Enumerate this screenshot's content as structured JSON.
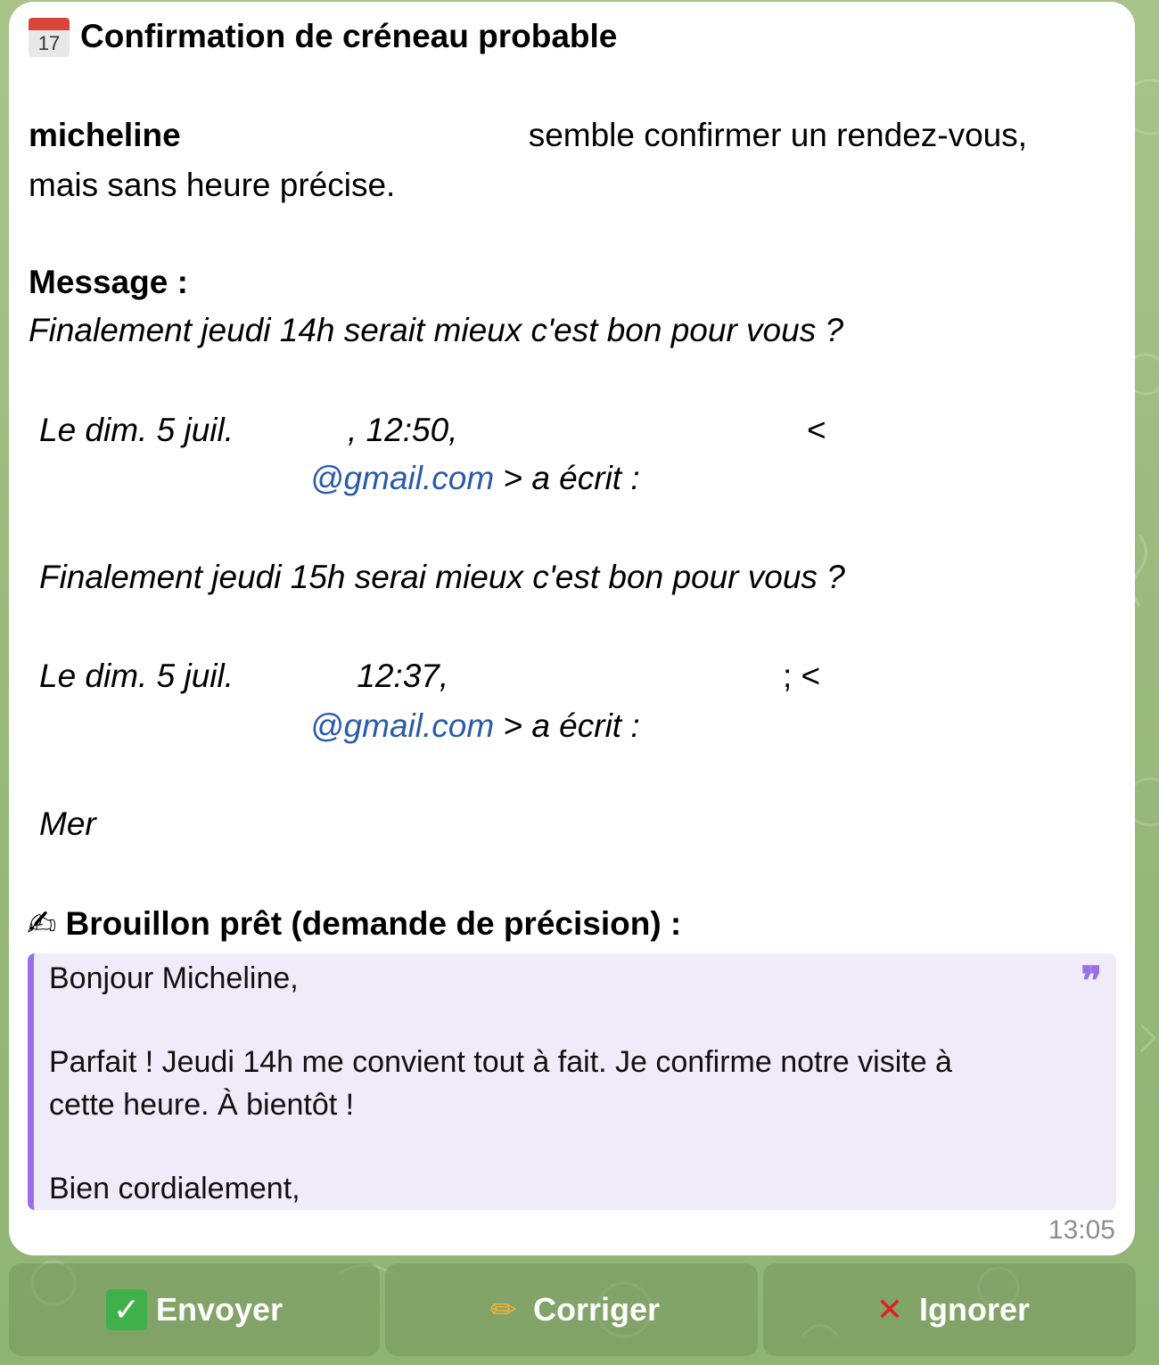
{
  "colors": {
    "wallpaper": "#a0bf85",
    "bubble": "#ffffff",
    "link": "#2a5aa8",
    "quote_background": "#efebf8",
    "quote_accent": "#9c6ee6",
    "timestamp": "#8e8e8e",
    "keyboard_button": "#7f9c68"
  },
  "header": {
    "icon": "calendar-icon",
    "calendar_number": "17",
    "title": "Confirmation de créneau probable"
  },
  "intro": {
    "name": "micheline",
    "text_end": "semble confirmer un rendez-vous,",
    "line2": "mais sans heure précise."
  },
  "message": {
    "label": "Message :",
    "body": "Finalement jeudi 14h serait mieux c'est bon pour vous ?"
  },
  "quoted_thread": [
    {
      "header_start": "Le dim. 5 juil.",
      "header_time": ", 12:50,",
      "header_lt": "<",
      "email_domain": "@gmail.com",
      "wrote": " > a écrit :",
      "body": "Finalement jeudi 15h serai mieux c'est bon pour vous ?"
    },
    {
      "header_start": "Le dim. 5 juil.",
      "header_time": " 12:37,",
      "header_lt": "; <",
      "email_domain": "@gmail.com",
      "wrote": " > a écrit :",
      "body": "Mer"
    }
  ],
  "draft": {
    "icon": "writing-hand-icon",
    "title": "Brouillon prêt (demande de précision) :",
    "quote_icon": "quote-icon",
    "quote_mark": "❞",
    "greeting": "Bonjour Micheline,",
    "line1": "Parfait ! Jeudi 14h me convient tout à fait. Je confirme notre visite à",
    "line2": "cette heure. À bientôt !",
    "closing": "Bien cordialement,"
  },
  "timestamp": "13:05",
  "buttons": [
    {
      "icon": "check-mark-icon",
      "glyph": "✓",
      "label": "Envoyer"
    },
    {
      "icon": "pencil-icon",
      "glyph": "✏",
      "label": "Corriger"
    },
    {
      "icon": "cross-mark-icon",
      "glyph": "✕",
      "label": "Ignorer"
    }
  ]
}
